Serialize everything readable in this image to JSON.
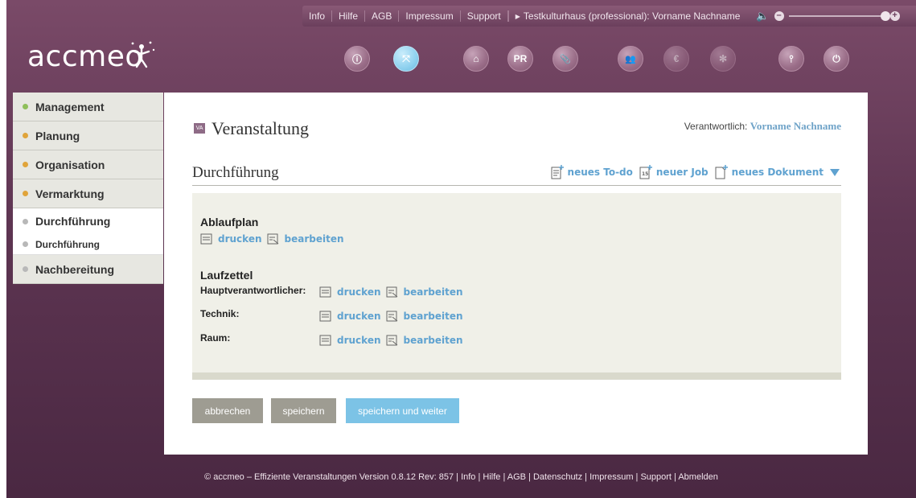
{
  "topbar": {
    "links": [
      "Info",
      "Hilfe",
      "AGB",
      "Impressum",
      "Support"
    ],
    "context": "Testkulturhaus (professional): Vorname Nachname",
    "vol_minus": "–",
    "vol_plus": "+"
  },
  "brand": {
    "logo_text": "accmeo"
  },
  "toolbar": {
    "tools": [
      {
        "name": "info-icon",
        "glyph": "ⓘ"
      },
      {
        "name": "arrows-icon",
        "glyph": "⤧"
      },
      {
        "name": "home-icon",
        "glyph": "⌂"
      },
      {
        "name": "pr-icon",
        "glyph": "PR"
      },
      {
        "name": "paperclip-icon",
        "glyph": "📎"
      },
      {
        "name": "people-icon",
        "glyph": "👥"
      },
      {
        "name": "euro-icon",
        "glyph": "€"
      },
      {
        "name": "puzzle-icon",
        "glyph": "✻"
      },
      {
        "name": "sliders-icon",
        "glyph": "⫯"
      },
      {
        "name": "power-icon",
        "glyph": "⏻"
      }
    ]
  },
  "sidebar": {
    "items": [
      {
        "label": "Management",
        "dot": "#8fbf5a"
      },
      {
        "label": "Planung",
        "dot": "#e0a43a"
      },
      {
        "label": "Organisation",
        "dot": "#e0a43a"
      },
      {
        "label": "Vermarktung",
        "dot": "#e0a43a"
      },
      {
        "label": "Durchführung",
        "dot": "#b8b8b8"
      },
      {
        "label": "Durchführung",
        "dot": "#b8b8b8"
      },
      {
        "label": "Nachbereitung",
        "dot": "#b8b8b8"
      }
    ]
  },
  "main": {
    "badge": "VA",
    "title": "Veranstaltung",
    "responsible_label": "Verantwortlich:",
    "responsible_name": "Vorname Nachname",
    "section_title": "Durchführung",
    "actions": {
      "new_todo": "neues To-do",
      "new_job": "neuer Job",
      "new_document": "neues Dokument"
    },
    "ablaufplan": {
      "heading": "Ablaufplan",
      "print": "drucken",
      "edit": "bearbeiten"
    },
    "laufzettel": {
      "heading": "Laufzettel",
      "rows": [
        {
          "label": "Hauptverantwortlicher:",
          "print": "drucken",
          "edit": "bearbeiten"
        },
        {
          "label": "Technik:",
          "print": "drucken",
          "edit": "bearbeiten"
        },
        {
          "label": "Raum:",
          "print": "drucken",
          "edit": "bearbeiten"
        }
      ]
    },
    "buttons": {
      "cancel": "abbrechen",
      "save": "speichern",
      "save_next": "speichern und weiter"
    }
  },
  "footer": {
    "text": "© accmeo – Effiziente Veranstaltungen Version 0.8.12 Rev: 857 | Info | Hilfe | AGB | Datenschutz | Impressum | Support | Abmelden"
  },
  "colors": {
    "brand_purple": "#6b3f5d",
    "link_blue": "#5fa2d0",
    "accent_button": "#7cc3e6"
  }
}
